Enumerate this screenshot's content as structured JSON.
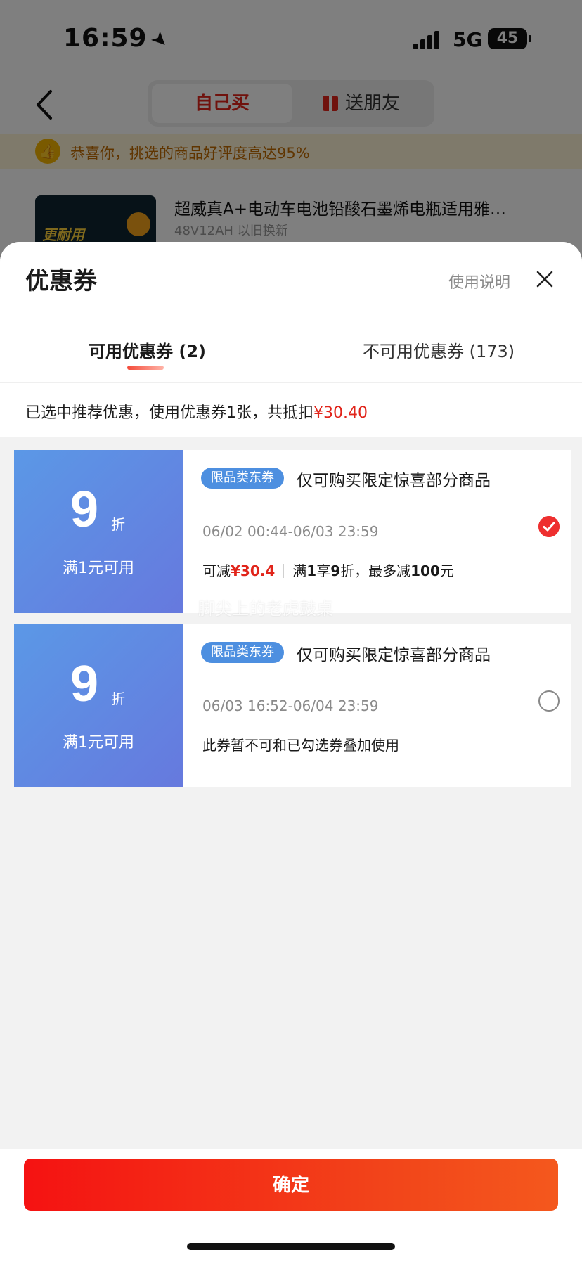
{
  "status_bar": {
    "time": "16:59",
    "network": "5G",
    "battery": "45"
  },
  "nav": {
    "segments": [
      "自己买",
      "送朋友"
    ],
    "active_segment": "自己买"
  },
  "background": {
    "praise_text": "恭喜你，挑选的商品好评度高达95%",
    "product": {
      "title": "超威真A+电动车电池铅酸石墨烯电瓶适用雅…",
      "spec": "48V12AH 以旧换新",
      "image_text": "更耐用"
    }
  },
  "sheet": {
    "title": "优惠券",
    "help_link": "使用说明",
    "tabs": [
      {
        "label": "可用优惠券 (2)",
        "active": true
      },
      {
        "label": "不可用优惠券 (173)",
        "active": false
      }
    ],
    "summary": {
      "text": "已选中推荐优惠，使用优惠券1张，共抵扣",
      "amount": "¥30.40"
    },
    "coupons": [
      {
        "value": "9",
        "unit": "折",
        "condition": "满1元可用",
        "tag": "限品类东券",
        "title": "仅可购买限定惊喜部分商品",
        "validity": "06/02 00:44-06/03 23:59",
        "desc_prefix": "可减",
        "desc_amount": "¥30.4",
        "desc_rule_1": "满",
        "desc_rule_2": "1",
        "desc_rule_3": "享",
        "desc_rule_4": "9",
        "desc_rule_5": "折，最多减",
        "desc_rule_6": "100",
        "desc_rule_7": "元",
        "selected": true
      },
      {
        "value": "9",
        "unit": "折",
        "condition": "满1元可用",
        "tag": "限品类东券",
        "title": "仅可购买限定惊喜部分商品",
        "validity": "06/03 16:52-06/04 23:59",
        "note": "此券暂不可和已勾选券叠加使用",
        "selected": false
      }
    ],
    "watermark": "脚尖上的老虎鼓桌",
    "confirm_label": "确定"
  },
  "colors": {
    "accent_red": "#e1251b",
    "coupon_blue": "#5b98e6",
    "tag_blue": "#4d8fe0"
  }
}
